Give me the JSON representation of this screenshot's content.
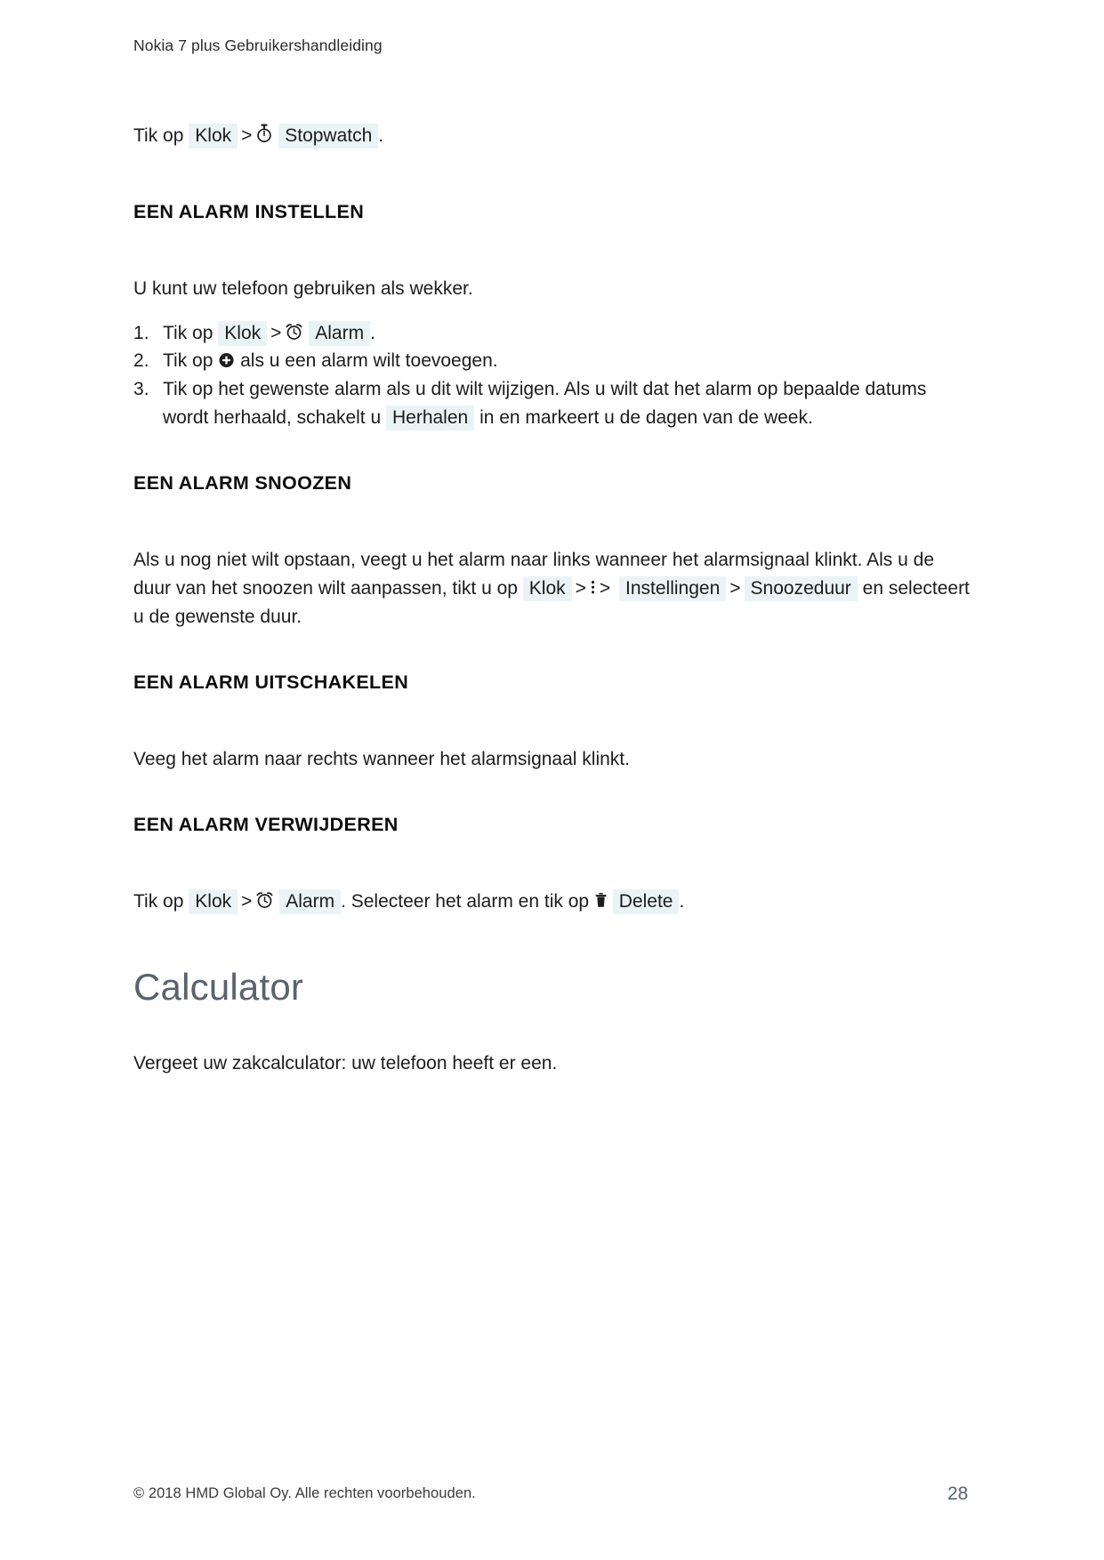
{
  "document": {
    "running_header": "Nokia 7 plus Gebruikershandleiding",
    "footer_copyright": "© 2018 HMD Global Oy. Alle rechten voorbehouden.",
    "page_number": "28"
  },
  "colors": {
    "ui_token_background": "#eaf4f7",
    "chapter_heading": "#59626e",
    "body_text": "#1c1c1c",
    "page_background": "#ffffff"
  },
  "stopwatch_line": {
    "lead": "Tik op",
    "token_klok": "Klok",
    "separator": ">",
    "icon": "stopwatch-icon",
    "token_stopwatch": "Stopwatch",
    "trailing": "."
  },
  "sections": [
    {
      "id": "set-alarm",
      "heading": "EEN ALARM INSTELLEN",
      "intro": "U kunt uw telefoon gebruiken als wekker.",
      "steps": [
        {
          "lead": "Tik op",
          "token_klok": "Klok",
          "separator": ">",
          "icon": "alarm-clock-icon",
          "token_alarm": "Alarm",
          "trailing": "."
        },
        {
          "lead": "Tik op",
          "icon": "plus-circle-icon",
          "tail": "als u een alarm wilt toevoegen."
        },
        {
          "part_1": "Tik op het gewenste alarm als u dit wilt wijzigen. Als u wilt dat het alarm op bepaalde datums wordt herhaald, schakelt u",
          "token_herhalen": "Herhalen",
          "part_2": "in en markeert u de dagen van de week."
        }
      ]
    },
    {
      "id": "snooze-alarm",
      "heading": "EEN ALARM SNOOZEN",
      "body_part_1": "Als u nog niet wilt opstaan, veegt u het alarm naar links wanneer het alarmsignaal klinkt. Als u de duur van het snoozen wilt aanpassen, tikt u op",
      "token_klok": "Klok",
      "separator_1": ">",
      "icon": "more-vert-icon",
      "separator_2": ">",
      "token_instellingen": "Instellingen",
      "separator_3": ">",
      "token_snoozeduur": "Snoozeduur",
      "body_part_2": "en selecteert u de gewenste duur."
    },
    {
      "id": "turn-off-alarm",
      "heading": "EEN ALARM UITSCHAKELEN",
      "body": "Veeg het alarm naar rechts wanneer het alarmsignaal klinkt."
    },
    {
      "id": "delete-alarm",
      "heading": "EEN ALARM VERWIJDEREN",
      "lead": "Tik op",
      "token_klok": "Klok",
      "separator_1": ">",
      "icon_alarm": "alarm-clock-icon",
      "token_alarm": "Alarm",
      "middle": ". Selecteer het alarm en tik op",
      "icon_delete": "trash-icon",
      "token_delete": "Delete",
      "trailing": "."
    }
  ],
  "chapter": {
    "title": "Calculator",
    "body": "Vergeet uw zakcalculator: uw telefoon heeft er een."
  }
}
